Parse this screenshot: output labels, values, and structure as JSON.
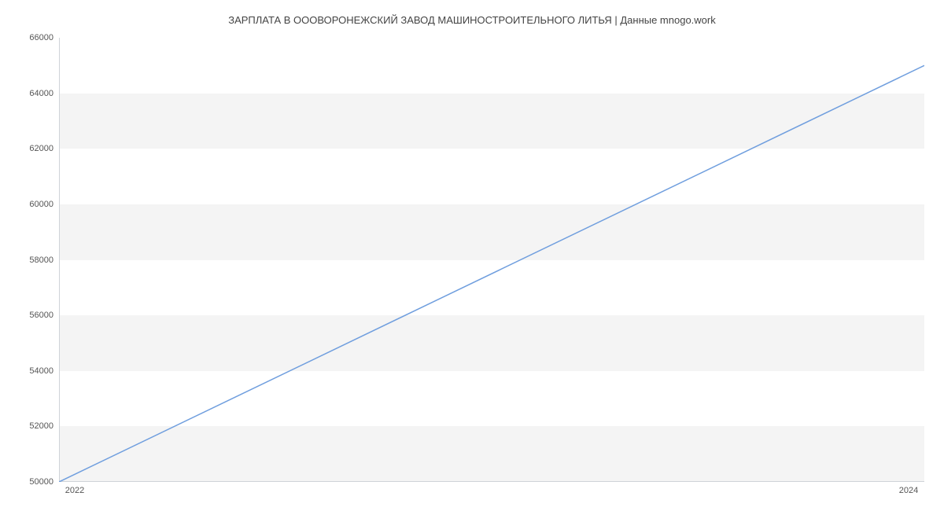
{
  "chart_data": {
    "type": "line",
    "title": "ЗАРПЛАТА В ОООВОРОНЕЖСКИЙ ЗАВОД МАШИНОСТРОИТЕЛЬНОГО ЛИТЬЯ | Данные mnogo.work",
    "xlabel": "",
    "ylabel": "",
    "x": [
      2022,
      2024
    ],
    "values": [
      50000,
      65000
    ],
    "x_ticks": [
      2022,
      2024
    ],
    "y_ticks": [
      50000,
      52000,
      54000,
      56000,
      58000,
      60000,
      62000,
      64000,
      66000
    ],
    "xlim": [
      2022,
      2024
    ],
    "ylim": [
      50000,
      66000
    ],
    "line_color": "#6f9ede",
    "band_color": "#f4f4f4"
  }
}
